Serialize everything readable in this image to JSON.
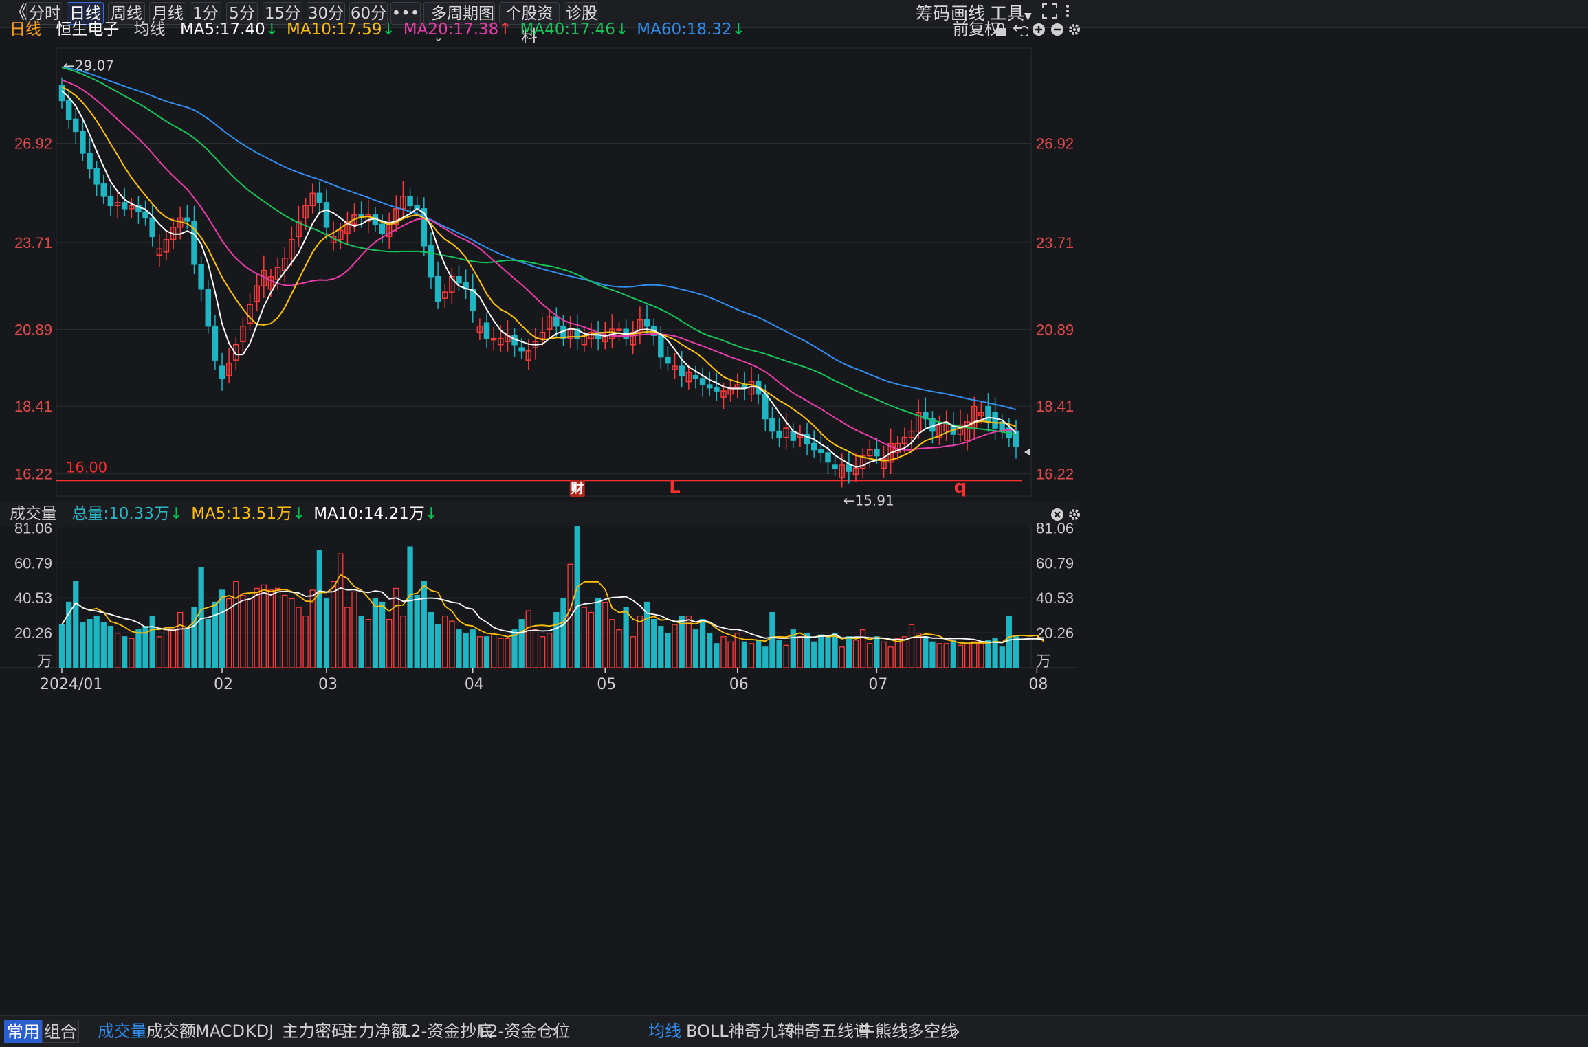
{
  "toolbar": {
    "collapse_icon": "《",
    "periods": [
      "分时",
      "日线",
      "周线",
      "月线",
      "1分",
      "5分",
      "15分",
      "30分",
      "60分"
    ],
    "active_period": "日线",
    "more_label": "•••",
    "multi_period": "多周期图",
    "profile": "个股资料",
    "diagnose": "诊股",
    "right": {
      "chips": "筹码",
      "draw": "画线",
      "tools": "工具"
    }
  },
  "stock": {
    "period": "日线",
    "name": "恒生电子",
    "ma_label": "均线",
    "adjust": "前复权",
    "ma_items": [
      {
        "text": "MA5:17.40",
        "dir": "↓",
        "color": "#ffffff"
      },
      {
        "text": "MA10:17.59",
        "dir": "↓",
        "color": "#ffc107"
      },
      {
        "text": "MA20:17.38",
        "dir": "↑",
        "color": "#e83ea8"
      },
      {
        "text": "MA40:17.46",
        "dir": "↓",
        "color": "#18c35a"
      },
      {
        "text": "MA60:18.32",
        "dir": "↓",
        "color": "#2f8ef0"
      }
    ]
  },
  "volume_panel": {
    "title": "成交量",
    "items": [
      {
        "text": "总量:10.33万",
        "dir": "↓",
        "color": "#2ab7c8"
      },
      {
        "text": "MA5:13.51万",
        "dir": "↓",
        "color": "#ffc107"
      },
      {
        "text": "MA10:14.21万",
        "dir": "↓",
        "color": "#ffffff"
      }
    ],
    "unit": "万"
  },
  "chart_data": {
    "type": "candlestick",
    "price_ticks": [
      26.92,
      23.71,
      20.89,
      18.41,
      16.22
    ],
    "price_ylim": [
      15.5,
      30.0
    ],
    "high_label": "←29.07",
    "low_label": "←15.91",
    "hline_label": "16.00",
    "hline_value": 16.0,
    "markers": [
      {
        "text": "财",
        "boxed": true
      },
      {
        "text": "L",
        "boxed": false
      },
      {
        "text": "q",
        "boxed": false
      }
    ],
    "volume_ticks": [
      81.06,
      60.79,
      40.53,
      20.26
    ],
    "volume_ylim": [
      0,
      82
    ],
    "x_labels": [
      "2024/01",
      "02",
      "03",
      "04",
      "05",
      "06",
      "07",
      "08"
    ],
    "month_start_index": [
      0,
      23,
      38,
      59,
      78,
      97,
      117,
      140
    ],
    "close": [
      28.3,
      27.7,
      27.3,
      26.6,
      26.1,
      25.6,
      25.2,
      24.9,
      25.0,
      24.8,
      24.9,
      24.7,
      24.5,
      23.9,
      23.5,
      23.8,
      24.2,
      24.5,
      24.4,
      23.0,
      22.2,
      21.0,
      19.9,
      19.3,
      19.8,
      20.4,
      21.0,
      21.7,
      22.3,
      22.8,
      22.6,
      22.9,
      23.2,
      23.8,
      24.4,
      24.9,
      25.3,
      25.0,
      24.2,
      23.9,
      24.1,
      24.4,
      24.6,
      24.5,
      24.6,
      24.3,
      24.0,
      24.3,
      24.8,
      25.2,
      24.9,
      24.8,
      23.6,
      22.6,
      21.8,
      22.1,
      22.6,
      22.4,
      22.2,
      21.5,
      21.0,
      20.6,
      20.6,
      20.6,
      20.7,
      20.4,
      20.2,
      20.2,
      20.5,
      20.8,
      21.3,
      21.0,
      20.6,
      20.9,
      20.6,
      20.7,
      20.8,
      20.6,
      20.7,
      20.9,
      20.9,
      20.6,
      20.8,
      21.2,
      21.0,
      20.7,
      20.0,
      19.8,
      19.7,
      19.4,
      19.5,
      19.3,
      19.1,
      19.0,
      18.9,
      18.9,
      19.0,
      19.1,
      19.0,
      19.2,
      18.8,
      18.0,
      17.6,
      17.4,
      17.7,
      17.3,
      17.5,
      17.2,
      17.0,
      16.9,
      16.6,
      16.4,
      16.5,
      16.3,
      16.4,
      16.8,
      17.0,
      16.8,
      16.7,
      17.2,
      17.2,
      17.4,
      17.6,
      18.2,
      18.0,
      17.6,
      17.8,
      17.9,
      17.5,
      17.8,
      17.9,
      18.4,
      18.2,
      17.9,
      17.7,
      17.6,
      17.4,
      17.1
    ],
    "open": [
      28.8,
      28.3,
      27.7,
      27.3,
      26.6,
      26.1,
      25.6,
      25.2,
      24.9,
      25.0,
      24.8,
      24.9,
      24.7,
      24.5,
      23.3,
      23.4,
      23.8,
      24.2,
      24.5,
      24.4,
      23.0,
      22.2,
      21.0,
      19.7,
      19.4,
      19.9,
      20.5,
      21.1,
      21.8,
      22.3,
      22.2,
      22.5,
      22.8,
      23.2,
      23.9,
      24.5,
      24.9,
      25.3,
      25.0,
      23.7,
      23.8,
      24.0,
      24.3,
      24.6,
      24.4,
      24.6,
      24.3,
      23.9,
      24.3,
      24.8,
      25.2,
      24.9,
      24.8,
      23.6,
      22.6,
      21.9,
      22.1,
      22.6,
      22.4,
      22.2,
      20.8,
      21.1,
      20.6,
      20.4,
      20.5,
      20.7,
      20.3,
      19.9,
      20.3,
      20.6,
      20.9,
      21.3,
      21.0,
      20.6,
      20.9,
      20.4,
      20.6,
      20.8,
      20.5,
      20.6,
      20.9,
      20.9,
      20.4,
      20.8,
      21.2,
      21.0,
      20.7,
      20.0,
      19.6,
      19.7,
      19.2,
      19.4,
      19.3,
      19.1,
      19.0,
      18.7,
      18.8,
      19.0,
      19.1,
      18.8,
      19.2,
      18.8,
      18.0,
      17.6,
      17.4,
      17.6,
      17.4,
      17.5,
      17.2,
      17.0,
      16.9,
      16.5,
      16.1,
      16.5,
      16.2,
      16.4,
      16.8,
      17.0,
      16.4,
      16.6,
      16.9,
      17.2,
      17.4,
      17.6,
      18.2,
      18.0,
      17.4,
      17.6,
      17.8,
      17.5,
      17.3,
      17.7,
      18.1,
      18.4,
      18.2,
      17.9,
      17.7,
      17.6,
      17.5
    ],
    "volume": [
      25,
      38,
      50,
      26,
      28,
      30,
      26,
      24,
      20,
      18,
      17,
      22,
      24,
      30,
      18,
      22,
      22,
      32,
      22,
      35,
      58,
      28,
      38,
      45,
      40,
      50,
      42,
      40,
      46,
      48,
      45,
      46,
      42,
      40,
      35,
      30,
      45,
      68,
      40,
      50,
      66,
      35,
      44,
      30,
      28,
      40,
      38,
      28,
      46,
      30,
      70,
      42,
      50,
      32,
      25,
      30,
      27,
      22,
      20,
      22,
      18,
      18,
      20,
      17,
      17,
      22,
      28,
      33,
      22,
      18,
      20,
      32,
      40,
      60,
      82,
      35,
      32,
      40,
      38,
      28,
      22,
      35,
      18,
      30,
      38,
      28,
      24,
      20,
      25,
      30,
      30,
      22,
      28,
      20,
      14,
      18,
      15,
      20,
      15,
      14,
      16,
      12,
      32,
      16,
      13,
      22,
      18,
      20,
      15,
      19,
      18,
      20,
      12,
      18,
      16,
      22,
      14,
      18,
      15,
      12,
      17,
      18,
      25,
      20,
      18,
      15,
      14,
      14,
      16,
      13,
      14,
      15,
      14,
      16,
      17,
      12,
      30,
      18,
      17,
      15,
      14,
      12
    ]
  },
  "bottom_bar": {
    "left_tabs": [
      "常用",
      "组合"
    ],
    "active_left": "常用",
    "indicators": [
      "成交量",
      "成交额",
      "MACD",
      "KDJ",
      "主力密码",
      "主力净额",
      "L2-资金抄底",
      "L2-资金仓位"
    ],
    "active_indicator": "成交量",
    "overlays": [
      "均线",
      "BOLL",
      "神奇九转",
      "神奇五线谱",
      "牛熊线",
      "多空线"
    ],
    "active_overlay": "均线",
    "next_icon": "›"
  },
  "colors": {
    "bg": "#17181c",
    "up": "#ff3b3b",
    "down": "#1fb5c3",
    "grid": "#2b2c33",
    "axis_text": "#e14b4b",
    "vol_axis_text": "#c9c9c9",
    "ma5": "#ffffff",
    "ma10": "#ffc107",
    "ma20": "#e83ea8",
    "ma40": "#18c35a",
    "ma60": "#2f8ef0"
  }
}
